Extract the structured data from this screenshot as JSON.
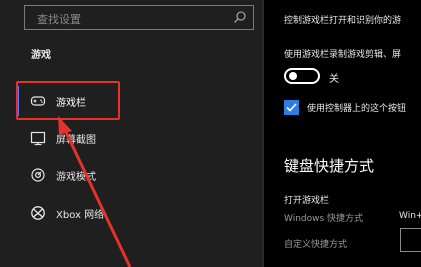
{
  "search": {
    "placeholder": "查找设置"
  },
  "sidebar": {
    "section_title": "游戏",
    "items": [
      {
        "label": "游戏栏",
        "icon": "game-bar-icon",
        "active": true
      },
      {
        "label": "屏幕截图",
        "icon": "screenshot-icon",
        "active": false
      },
      {
        "label": "游戏模式",
        "icon": "game-mode-icon",
        "active": false
      },
      {
        "label": "Xbox 网络",
        "icon": "xbox-icon",
        "active": false
      }
    ]
  },
  "content": {
    "intro": "控制游戏栏打开和识别你的游",
    "record_label": "使用游戏栏录制游戏剪辑、屏",
    "toggle_state": "关",
    "checkbox_label": "使用控制器上的这个按钮",
    "heading": "键盘快捷方式",
    "open_game_bar": "打开游戏栏",
    "windows_shortcut_label": "Windows 快捷方式",
    "windows_shortcut_value": "Win+",
    "custom_shortcut_label": "自定义快捷方式"
  },
  "colors": {
    "accent": "#5a76ff",
    "checkbox": "#2f7de1",
    "highlight": "#e3332b"
  }
}
